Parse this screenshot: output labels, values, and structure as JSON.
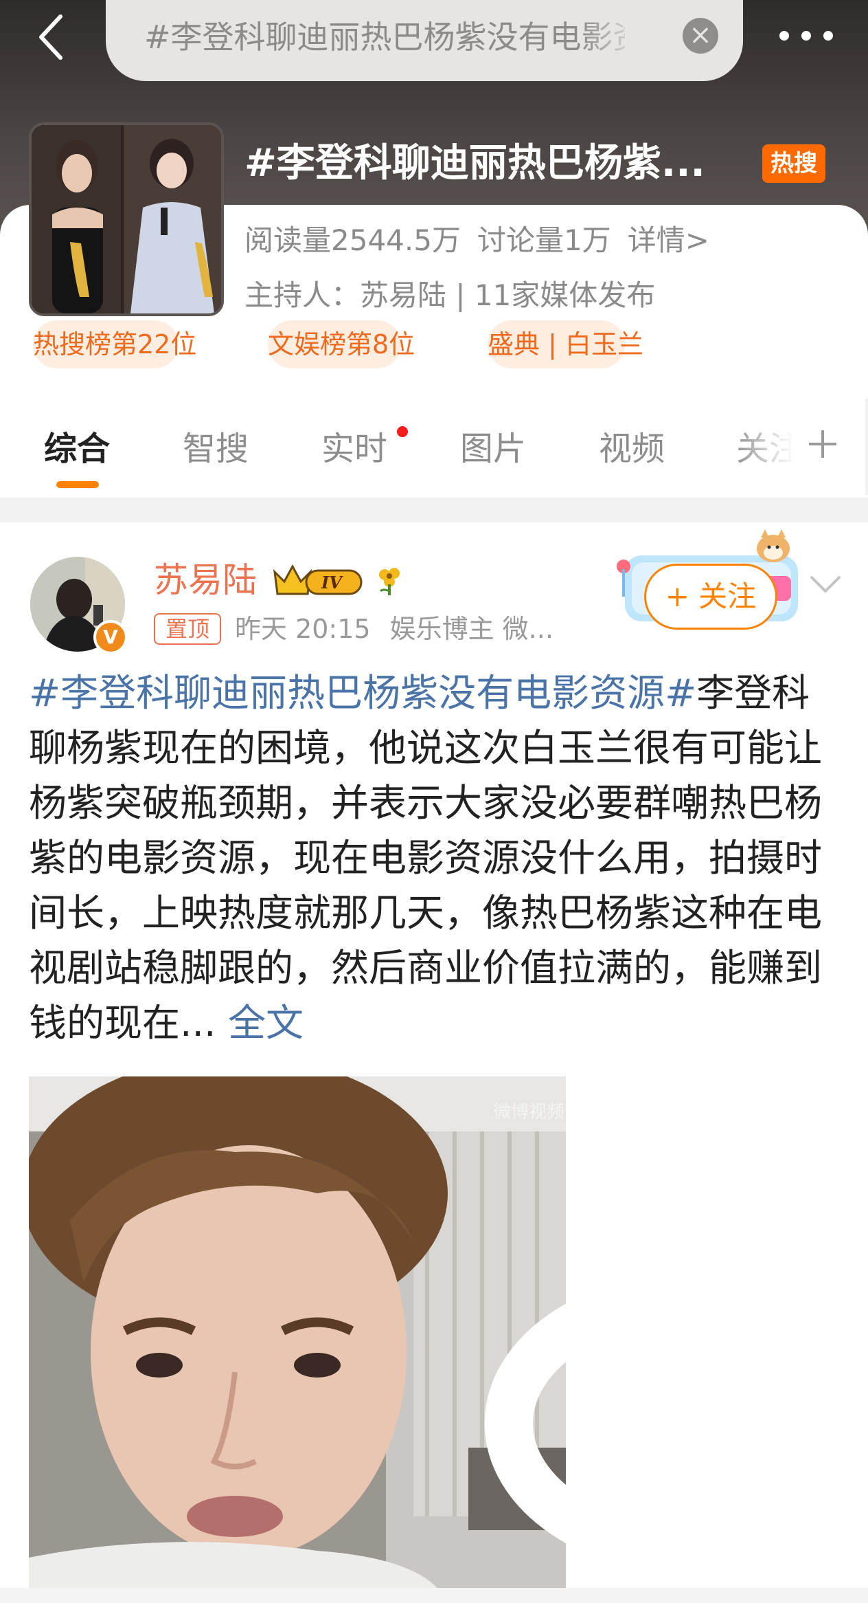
{
  "topbar": {
    "search_text": "#李登科聊迪丽热巴杨紫没有电影资源#",
    "back_icon": "chevron-left-icon",
    "clear_icon": "clear-icon",
    "more_icon": "more-dots-icon"
  },
  "topic": {
    "title": "#李登科聊迪丽热巴杨紫...",
    "hot_badge": "热搜",
    "reads": "阅读量2544.5万",
    "discussions": "讨论量1万",
    "details_link": "详情>",
    "host": "主持人：苏易陆 | 11家媒体发布",
    "tags": [
      "热搜榜第22位",
      "文娱榜第8位",
      "盛典 | 白玉兰"
    ]
  },
  "tabs": [
    {
      "label": "综合",
      "active": true
    },
    {
      "label": "智搜",
      "active": false
    },
    {
      "label": "实时",
      "active": false,
      "dot": true
    },
    {
      "label": "图片",
      "active": false
    },
    {
      "label": "视频",
      "active": false
    },
    {
      "label": "关注",
      "active": false
    }
  ],
  "post": {
    "author": "苏易陆",
    "level": "IV",
    "pinned": "置顶",
    "time": "昨天 20:15",
    "source": "娱乐博主 微...",
    "follow_label": "+ 关注",
    "hashtag": "#李登科聊迪丽热巴杨紫没有电影资源#",
    "body": "李登科聊杨紫现在的困境，他说这次白玉兰很有可能让杨紫突破瓶颈期，并表示大家没必要群嘲热巴杨紫的电影资源，现在电影资源没什么用，拍摄时间长，上映热度就那几天，像热巴杨紫这种在电视剧站稳脚跟的，然后商业价值拉满的，能赚到钱的现在...",
    "full_text": "全文",
    "video_watermark": "微博视频"
  },
  "colors": {
    "accent": "#ff8200",
    "link": "#4a73a8",
    "author": "#eb7350",
    "hot": "#ff6a00"
  }
}
